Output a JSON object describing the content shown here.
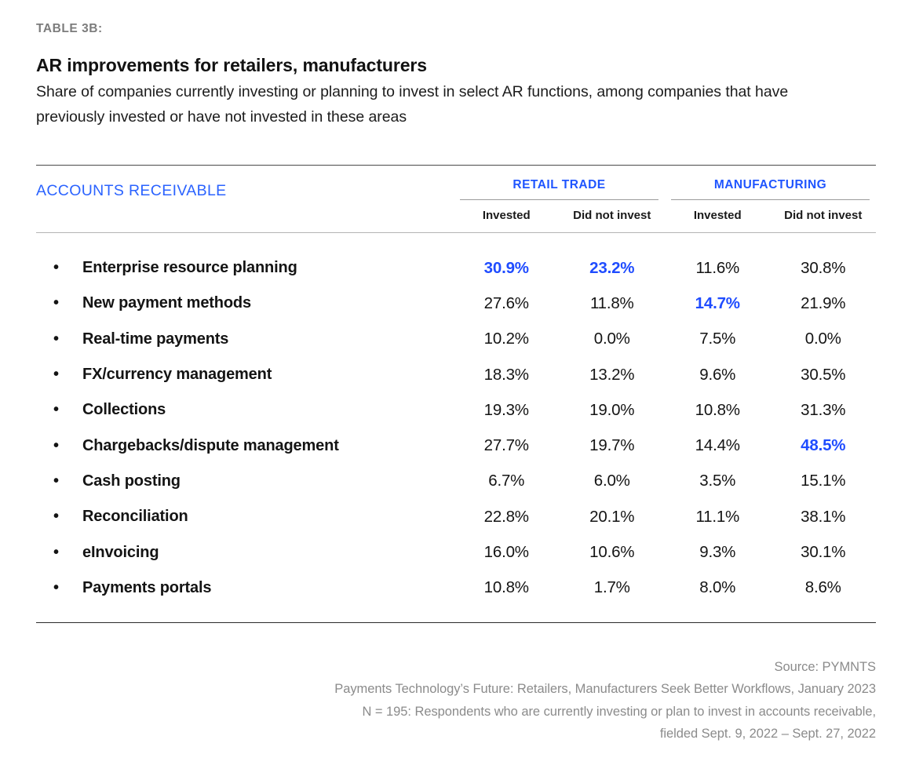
{
  "header": {
    "eyebrow": "TABLE 3B:",
    "title": "AR improvements for retailers, manufacturers",
    "subtitle": "Share of companies currently investing or planning to invest in select AR functions, among companies that have previously invested or have not invested in these areas"
  },
  "table": {
    "section_label": "ACCOUNTS RECEIVABLE",
    "groups": [
      {
        "label": "RETAIL TRADE"
      },
      {
        "label": "MANUFACTURING"
      }
    ],
    "subheaders": [
      "Invested",
      "Did not invest",
      "Invested",
      "Did not invest"
    ],
    "bullet": "•",
    "rows": [
      {
        "label": "Enterprise resource planning",
        "values": [
          "30.9%",
          "23.2%",
          "11.6%",
          "30.8%"
        ],
        "highlight": [
          true,
          true,
          false,
          false
        ]
      },
      {
        "label": "New payment methods",
        "values": [
          "27.6%",
          "11.8%",
          "14.7%",
          "21.9%"
        ],
        "highlight": [
          false,
          false,
          true,
          false
        ]
      },
      {
        "label": "Real-time payments",
        "values": [
          "10.2%",
          "0.0%",
          "7.5%",
          "0.0%"
        ],
        "highlight": [
          false,
          false,
          false,
          false
        ]
      },
      {
        "label": "FX/currency management",
        "values": [
          "18.3%",
          "13.2%",
          "9.6%",
          "30.5%"
        ],
        "highlight": [
          false,
          false,
          false,
          false
        ]
      },
      {
        "label": "Collections",
        "values": [
          "19.3%",
          "19.0%",
          "10.8%",
          "31.3%"
        ],
        "highlight": [
          false,
          false,
          false,
          false
        ]
      },
      {
        "label": "Chargebacks/dispute management",
        "values": [
          "27.7%",
          "19.7%",
          "14.4%",
          "48.5%"
        ],
        "highlight": [
          false,
          false,
          false,
          true
        ]
      },
      {
        "label": "Cash posting",
        "values": [
          "6.7%",
          "6.0%",
          "3.5%",
          "15.1%"
        ],
        "highlight": [
          false,
          false,
          false,
          false
        ]
      },
      {
        "label": "Reconciliation",
        "values": [
          "22.8%",
          "20.1%",
          "11.1%",
          "38.1%"
        ],
        "highlight": [
          false,
          false,
          false,
          false
        ]
      },
      {
        "label": "eInvoicing",
        "values": [
          "16.0%",
          "10.6%",
          "9.3%",
          "30.1%"
        ],
        "highlight": [
          false,
          false,
          false,
          false
        ]
      },
      {
        "label": "Payments portals",
        "values": [
          "10.8%",
          "1.7%",
          "8.0%",
          "8.6%"
        ],
        "highlight": [
          false,
          false,
          false,
          false
        ]
      }
    ]
  },
  "footer": {
    "lines": [
      "Source: PYMNTS",
      "Payments Technology’s Future: Retailers, Manufacturers Seek Better Workflows, January 2023",
      "N = 195: Respondents who are currently investing or plan to invest in accounts receivable,",
      "fielded Sept. 9, 2022 – Sept. 27, 2022"
    ]
  },
  "colors": {
    "accent_blue": "#1f4cff",
    "section_blue": "#2b63ff",
    "eyebrow_gray": "#7c7c7c",
    "footer_gray": "#8b8b8b"
  },
  "chart_data": {
    "type": "table",
    "title": "AR improvements for retailers, manufacturers",
    "subtitle": "Share of companies currently investing or planning to invest in select AR functions, among companies that have previously invested or have not invested in these areas",
    "row_label_header": "ACCOUNTS RECEIVABLE",
    "column_groups": [
      "RETAIL TRADE",
      "MANUFACTURING"
    ],
    "columns": [
      "Retail Trade - Invested",
      "Retail Trade - Did not invest",
      "Manufacturing - Invested",
      "Manufacturing - Did not invest"
    ],
    "categories": [
      "Enterprise resource planning",
      "New payment methods",
      "Real-time payments",
      "FX/currency management",
      "Collections",
      "Chargebacks/dispute management",
      "Cash posting",
      "Reconciliation",
      "eInvoicing",
      "Payments portals"
    ],
    "series": [
      {
        "name": "Retail Trade - Invested",
        "values": [
          30.9,
          27.6,
          10.2,
          18.3,
          19.3,
          27.7,
          6.7,
          22.8,
          16.0,
          10.8
        ]
      },
      {
        "name": "Retail Trade - Did not invest",
        "values": [
          23.2,
          11.8,
          0.0,
          13.2,
          19.0,
          19.7,
          6.0,
          20.1,
          10.6,
          1.7
        ]
      },
      {
        "name": "Manufacturing - Invested",
        "values": [
          11.6,
          14.7,
          7.5,
          9.6,
          10.8,
          14.4,
          3.5,
          11.1,
          9.3,
          8.0
        ]
      },
      {
        "name": "Manufacturing - Did not invest",
        "values": [
          30.8,
          21.9,
          0.0,
          30.5,
          31.3,
          48.5,
          15.1,
          38.1,
          30.1,
          8.6
        ]
      }
    ],
    "units": "percent",
    "highlighted_cells": [
      {
        "row": "Enterprise resource planning",
        "column": "Retail Trade - Invested",
        "value": 30.9
      },
      {
        "row": "Enterprise resource planning",
        "column": "Retail Trade - Did not invest",
        "value": 23.2
      },
      {
        "row": "New payment methods",
        "column": "Manufacturing - Invested",
        "value": 14.7
      },
      {
        "row": "Chargebacks/dispute management",
        "column": "Manufacturing - Did not invest",
        "value": 48.5
      }
    ],
    "source": "PYMNTS",
    "notes": [
      "Payments Technology’s Future: Retailers, Manufacturers Seek Better Workflows, January 2023",
      "N = 195: Respondents who are currently investing or plan to invest in accounts receivable,",
      "fielded Sept. 9, 2022 – Sept. 27, 2022"
    ]
  }
}
